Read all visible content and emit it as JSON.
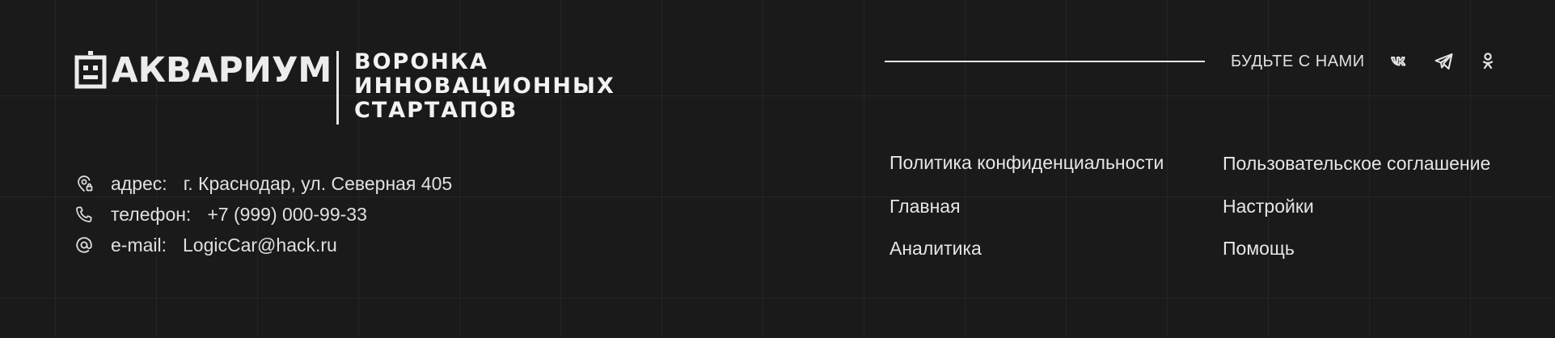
{
  "logo": {
    "name": "АКВАРИУМ",
    "tagline": [
      "ВОРОНКА",
      "ИННОВАЦИОННЫХ",
      "СТАРТАПОВ"
    ]
  },
  "contacts": [
    {
      "icon": "map-pin-icon",
      "label": "адрес:",
      "value": "г. Краснодар, ул. Северная 405"
    },
    {
      "icon": "phone-icon",
      "label": "телефон:",
      "value": "+7 (999) 000-99-33"
    },
    {
      "icon": "at-icon",
      "label": "e-mail:",
      "value": "LogicCar@hack.ru"
    }
  ],
  "social": {
    "label": "БУДЬТЕ С НАМИ",
    "icons": [
      "vk-icon",
      "telegram-icon",
      "odnoklassniki-icon"
    ]
  },
  "nav": {
    "privacy": "Политика конфиденциальности",
    "agreement": "Пользовательское соглашение",
    "home": "Главная",
    "settings": "Настройки",
    "analytics": "Аналитика",
    "help": "Помощь"
  },
  "colors": {
    "background": "#1a1a1a",
    "text": "#e6e6e6",
    "grid": "#2a2a2a"
  }
}
